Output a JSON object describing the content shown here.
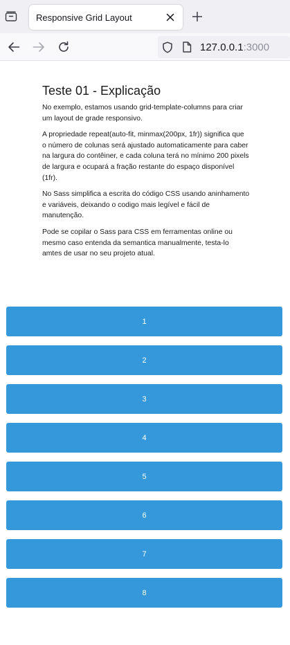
{
  "browser": {
    "tab_title": "Responsive Grid Layout",
    "url_host": "127.0.0.1",
    "url_port": ":3000",
    "icons": {
      "tab_list": "tab-list-icon",
      "close": "close-icon",
      "new_tab": "plus-icon",
      "back": "arrow-left-icon",
      "forward": "arrow-right-icon",
      "reload": "reload-icon",
      "shield": "shield-icon",
      "page": "page-icon"
    }
  },
  "content": {
    "heading": "Teste 01 - Explicação",
    "paragraphs": [
      "No exemplo, estamos usando grid-template-columns para criar um layout de grade responsivo.",
      "A propriedade repeat(auto-fit, minmax(200px, 1fr)) significa que o número de colunas será ajustado automaticamente para caber na largura do contêiner, e cada coluna terá no mínimo 200 pixels de largura e ocupará a fração restante do espaço disponível (1fr).",
      "No Sass simplifica a escrita do código CSS usando aninhamento e variáveis, deixando o codigo mais legível e fácil de manutenção.",
      "Pode se copilar o Sass para CSS em ferramentas online ou mesmo caso entenda da semantica manualmente, testa-lo amtes de usar no seu projeto atual."
    ]
  },
  "grid": {
    "items": [
      "1",
      "2",
      "3",
      "4",
      "5",
      "6",
      "7",
      "8"
    ],
    "color": "#3498db"
  }
}
